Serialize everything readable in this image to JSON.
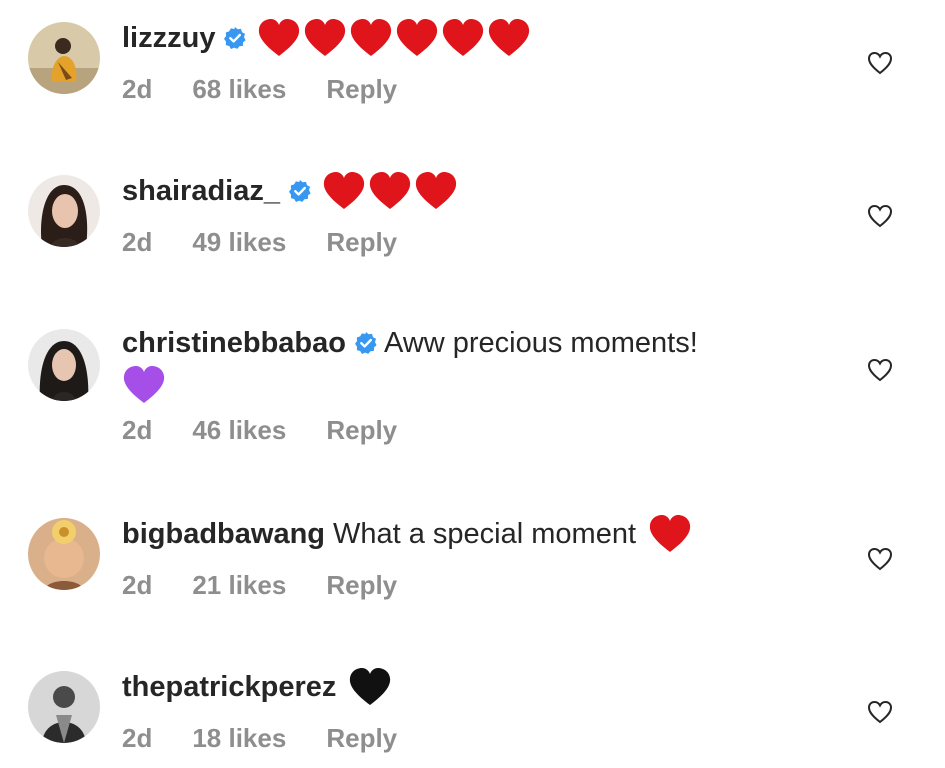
{
  "comments": [
    {
      "username": "lizzzuy",
      "verified": true,
      "text": "",
      "emoji": "red-heart x6",
      "time": "2d",
      "likes": "68 likes",
      "reply": "Reply"
    },
    {
      "username": "shairadiaz_",
      "verified": true,
      "text": "",
      "emoji": "red-heart x3",
      "time": "2d",
      "likes": "49 likes",
      "reply": "Reply"
    },
    {
      "username": "christinebbabao",
      "verified": true,
      "text": "Aww precious moments!",
      "emoji": "purple-heart x1",
      "time": "2d",
      "likes": "46 likes",
      "reply": "Reply"
    },
    {
      "username": "bigbadbawang",
      "verified": false,
      "text": "What a special moment",
      "emoji": "red-heart x1",
      "time": "2d",
      "likes": "21 likes",
      "reply": "Reply"
    },
    {
      "username": "thepatrickperez",
      "verified": false,
      "text": "",
      "emoji": "black-heart x1",
      "time": "2d",
      "likes": "18 likes",
      "reply": "Reply"
    }
  ],
  "colors": {
    "text": "#262626",
    "meta": "#8e8e8e",
    "verified": "#3897f0",
    "red_heart": "#e0141b",
    "purple_heart": "#a64ee8",
    "black_heart": "#111111"
  },
  "icons": {
    "verified": "verified-badge-icon",
    "like": "heart-outline-icon"
  }
}
